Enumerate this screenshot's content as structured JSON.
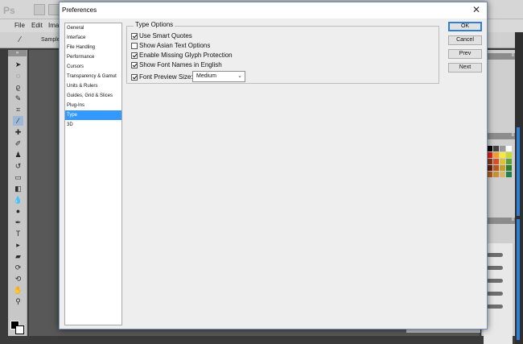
{
  "app": {
    "logo": "Ps",
    "menu": [
      "File",
      "Edit",
      "Ima"
    ],
    "options_bar": {
      "sample_label": "Sample"
    }
  },
  "dialog": {
    "title": "Preferences",
    "close_glyph": "✕",
    "categories": [
      {
        "label": "General",
        "selected": false
      },
      {
        "label": "Interface",
        "selected": false
      },
      {
        "label": "File Handling",
        "selected": false
      },
      {
        "label": "Performance",
        "selected": false
      },
      {
        "label": "Cursors",
        "selected": false
      },
      {
        "label": "Transparency & Gamut",
        "selected": false
      },
      {
        "label": "Units & Rulers",
        "selected": false
      },
      {
        "label": "Guides, Grid & Slices",
        "selected": false
      },
      {
        "label": "Plug-Ins",
        "selected": false
      },
      {
        "label": "Type",
        "selected": true
      },
      {
        "label": "3D",
        "selected": false
      }
    ],
    "group_title": "Type Options",
    "options": [
      {
        "label": "Use Smart Quotes",
        "checked": true
      },
      {
        "label": "Show Asian Text Options",
        "checked": false
      },
      {
        "label": "Enable Missing Glyph Protection",
        "checked": true
      },
      {
        "label": "Show Font Names in English",
        "checked": true
      },
      {
        "label": "Font Preview Size:",
        "checked": true
      }
    ],
    "font_preview_size": {
      "value": "Medium",
      "chevron": "⌄"
    },
    "buttons": {
      "ok": "OK",
      "cancel": "Cancel",
      "prev": "Prev",
      "next": "Next"
    }
  },
  "colors": {
    "selection": "#3399ff",
    "dialog_bg": "#eeeeee",
    "canvas_bg": "#585858",
    "accent_blue": "#2f7fd4"
  }
}
